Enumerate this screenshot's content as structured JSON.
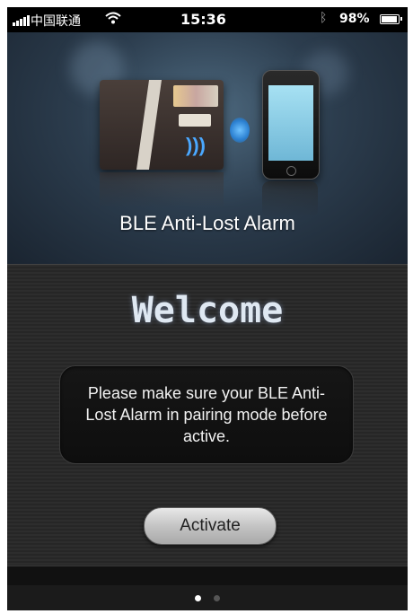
{
  "status_bar": {
    "carrier": "中国联通",
    "time": "15:36",
    "battery_percent": "98%",
    "battery_level": 0.98,
    "icons": [
      "signal-icon",
      "wifi-icon",
      "bluetooth-icon",
      "battery-icon"
    ]
  },
  "hero": {
    "app_title": "BLE Anti-Lost Alarm"
  },
  "main": {
    "welcome": "Welcome",
    "message": "Please make sure your BLE Anti-Lost Alarm in pairing mode before active.",
    "activate_label": "Activate"
  },
  "pager": {
    "pages": 2,
    "current": 1
  },
  "colors": {
    "accent_blue": "#4aa8ff",
    "welcome_text": "#dfe8f2",
    "panel_bg": "#262626"
  }
}
